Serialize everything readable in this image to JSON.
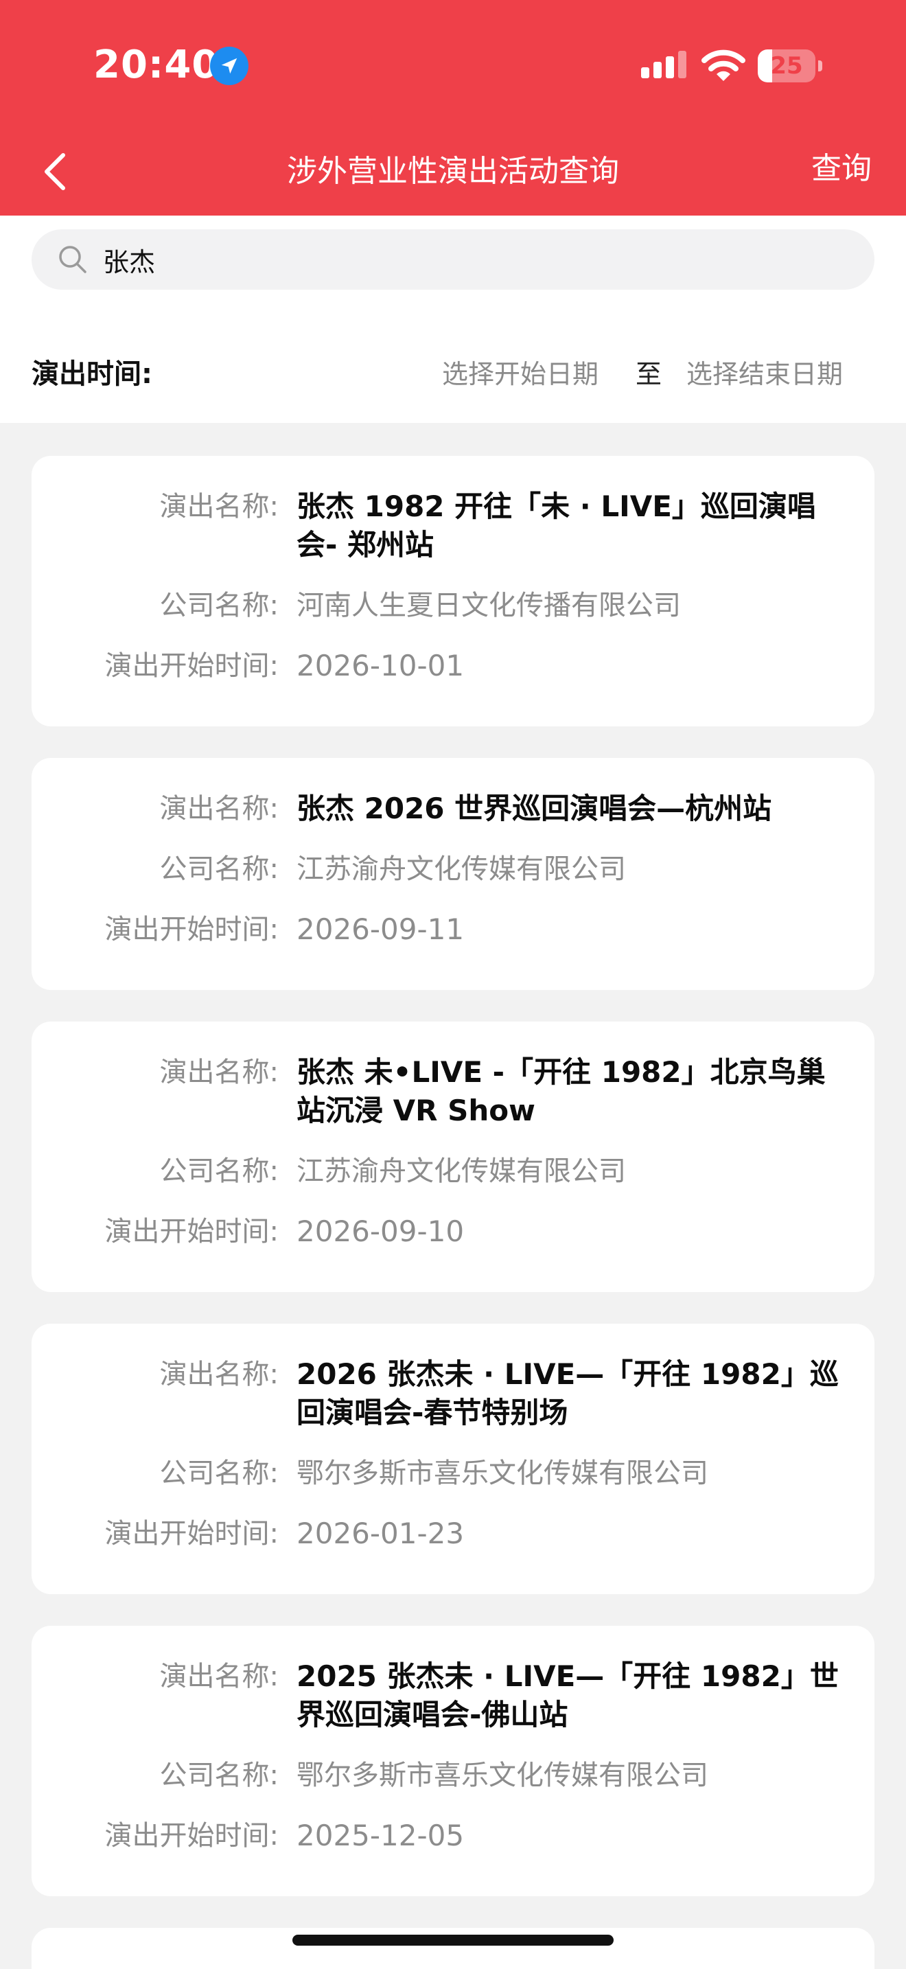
{
  "status_bar": {
    "time": "20:40",
    "battery_level": "25",
    "battery_fraction": 0.25
  },
  "nav": {
    "title": "涉外营业性演出活动查询",
    "query_label": "查询"
  },
  "search": {
    "value": "张杰"
  },
  "date_filter": {
    "label": "演出时间:",
    "start_placeholder": "选择开始日期",
    "separator": "至",
    "end_placeholder": "选择结束日期"
  },
  "labels": {
    "name": "演出名称:",
    "company": "公司名称:",
    "start_time": "演出开始时间:"
  },
  "results": [
    {
      "name": "张杰 1982 开往「未 · LIVE」巡回演唱会- 郑州站",
      "company": "河南人生夏日文化传播有限公司",
      "start_time": "2026-10-01"
    },
    {
      "name": "张杰 2026 世界巡回演唱会—杭州站",
      "company": "江苏渝舟文化传媒有限公司",
      "start_time": "2026-09-11"
    },
    {
      "name": "张杰 未•LIVE -「开往 1982」北京鸟巢站沉浸 VR Show",
      "company": "江苏渝舟文化传媒有限公司",
      "start_time": "2026-09-10"
    },
    {
      "name": "2026 张杰未 · LIVE—「开往 1982」巡回演唱会-春节特别场",
      "company": "鄂尔多斯市喜乐文化传媒有限公司",
      "start_time": "2026-01-23"
    },
    {
      "name": "2025 张杰未 · LIVE—「开往 1982」世界巡回演唱会-佛山站",
      "company": "鄂尔多斯市喜乐文化传媒有限公司",
      "start_time": "2025-12-05"
    }
  ],
  "colors": {
    "brand_red": "#ef4049",
    "page_bg": "#f2f2f2",
    "muted_text": "#8c8c8c"
  }
}
